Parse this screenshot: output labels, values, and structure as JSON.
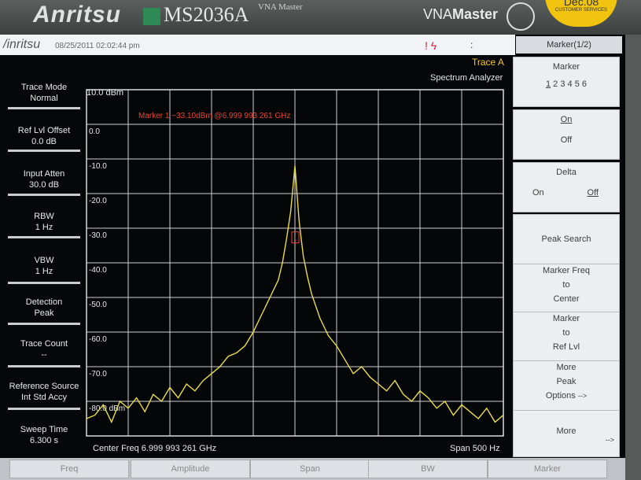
{
  "bezel": {
    "brand": "Anritsu",
    "model": "MS2036A",
    "model_sub": "VNA Master",
    "product_line_a": "VNA",
    "product_line_b": "Master",
    "sticker_title": "Dec.08",
    "sticker_sub": "CUSTOMER SERVICES"
  },
  "status": {
    "logo": "/inritsu",
    "datetime": "08/25/2011 02:02:44 pm",
    "icon_text": "!  ϟ",
    "dots": ":"
  },
  "trace_label": "Trace A",
  "mode_title": "Spectrum Analyzer",
  "left_params": [
    {
      "label": "Trace Mode",
      "value": "Normal"
    },
    {
      "label": "Ref Lvl Offset",
      "value": "0.0 dB"
    },
    {
      "label": "Input Atten",
      "value": "30.0 dB"
    },
    {
      "label": "RBW",
      "value": "1 Hz"
    },
    {
      "label": "VBW",
      "value": "1 Hz"
    },
    {
      "label": "Detection",
      "value": "Peak"
    },
    {
      "label": "Trace Count",
      "value": "--"
    },
    {
      "label": "Reference Source",
      "value": "Int Std Accy"
    },
    {
      "label": "Sweep Time",
      "value": "6.300 s"
    }
  ],
  "plot": {
    "ref_level": "10.0 dBm",
    "marker_readout": "Marker 1 −33.10dBm @6.999 993 261 GHz",
    "y_ticks": [
      "0.0",
      "-10.0",
      "-20.0",
      "-30.0",
      "-40.0",
      "-50.0",
      "-60.0",
      "-70.0",
      "-80.0 dBm"
    ],
    "center_freq": "Center Freq 6.999 993 261 GHz",
    "span": "Span 500 Hz",
    "trace_color": "#e8dc4a",
    "marker_value_dbm": -33.1,
    "marker_freq_offset_hz": 0
  },
  "chart_data": {
    "type": "line",
    "x_unit": "Hz offset from center",
    "x": [
      -250,
      -240,
      -230,
      -220,
      -210,
      -200,
      -190,
      -180,
      -170,
      -160,
      -150,
      -140,
      -130,
      -120,
      -110,
      -100,
      -90,
      -80,
      -70,
      -60,
      -50,
      -40,
      -30,
      -20,
      -15,
      -10,
      -5,
      0,
      5,
      10,
      15,
      20,
      30,
      40,
      50,
      60,
      70,
      80,
      90,
      100,
      110,
      120,
      130,
      140,
      150,
      160,
      170,
      180,
      190,
      200,
      210,
      220,
      230,
      240,
      250
    ],
    "values": [
      -85,
      -84,
      -81,
      -86,
      -80,
      -82,
      -79,
      -83,
      -78,
      -80,
      -76,
      -79,
      -75,
      -77,
      -74,
      -72,
      -70,
      -67,
      -66,
      -64,
      -60,
      -55,
      -50,
      -45,
      -40,
      -33,
      -25,
      -12,
      -28,
      -38,
      -44,
      -49,
      -56,
      -61,
      -64,
      -68,
      -72,
      -70,
      -73,
      -75,
      -77,
      -74,
      -78,
      -80,
      -77,
      -79,
      -82,
      -80,
      -84,
      -81,
      -83,
      -85,
      -82,
      -86,
      -84
    ],
    "ylim": [
      -90,
      10
    ]
  },
  "softkeys": {
    "header": "Marker(1/2)",
    "marker_title": "Marker",
    "marker_selected": "1",
    "marker_others": "2 3 4 5 6",
    "on": "On",
    "off": "Off",
    "delta": "Delta",
    "delta_on": "On",
    "delta_off": "Off",
    "peak_search": "Peak Search",
    "mf_line1": "Marker Freq",
    "mf_line2": "to",
    "mf_line3": "Center",
    "mr_line1": "Marker",
    "mr_line2": "to",
    "mr_line3": "Ref Lvl",
    "mpo_line1": "More",
    "mpo_line2": "Peak",
    "mpo_line3": "Options",
    "arrow": "-->",
    "more": "More"
  },
  "tabs": [
    "Freq",
    "Amplitude",
    "Span",
    "BW",
    "Marker"
  ]
}
